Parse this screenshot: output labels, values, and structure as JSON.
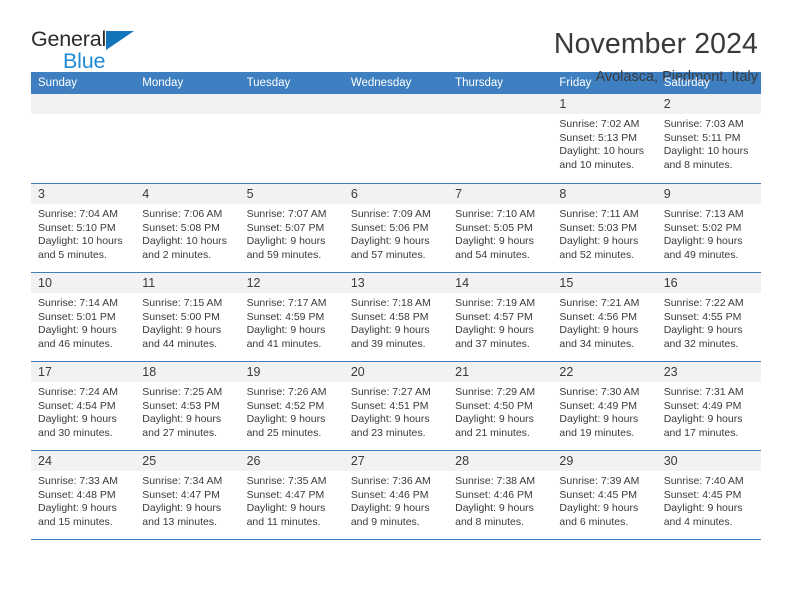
{
  "brand": {
    "name_part1": "General",
    "name_part2": "Blue",
    "logo_icon": "triangle-logo-icon",
    "accent_color": "#1275bc"
  },
  "header": {
    "month_title": "November 2024",
    "location": "Avolasca, Piedmont, Italy"
  },
  "calendar": {
    "header_color": "#3d7fc1",
    "daynum_band_color": "#f2f2f2",
    "weekdays": [
      "Sunday",
      "Monday",
      "Tuesday",
      "Wednesday",
      "Thursday",
      "Friday",
      "Saturday"
    ],
    "weeks": [
      [
        {
          "empty": true
        },
        {
          "empty": true
        },
        {
          "empty": true
        },
        {
          "empty": true
        },
        {
          "empty": true
        },
        {
          "day": "1",
          "sunrise": "Sunrise: 7:02 AM",
          "sunset": "Sunset: 5:13 PM",
          "daylight": "Daylight: 10 hours and 10 minutes."
        },
        {
          "day": "2",
          "sunrise": "Sunrise: 7:03 AM",
          "sunset": "Sunset: 5:11 PM",
          "daylight": "Daylight: 10 hours and 8 minutes."
        }
      ],
      [
        {
          "day": "3",
          "sunrise": "Sunrise: 7:04 AM",
          "sunset": "Sunset: 5:10 PM",
          "daylight": "Daylight: 10 hours and 5 minutes."
        },
        {
          "day": "4",
          "sunrise": "Sunrise: 7:06 AM",
          "sunset": "Sunset: 5:08 PM",
          "daylight": "Daylight: 10 hours and 2 minutes."
        },
        {
          "day": "5",
          "sunrise": "Sunrise: 7:07 AM",
          "sunset": "Sunset: 5:07 PM",
          "daylight": "Daylight: 9 hours and 59 minutes."
        },
        {
          "day": "6",
          "sunrise": "Sunrise: 7:09 AM",
          "sunset": "Sunset: 5:06 PM",
          "daylight": "Daylight: 9 hours and 57 minutes."
        },
        {
          "day": "7",
          "sunrise": "Sunrise: 7:10 AM",
          "sunset": "Sunset: 5:05 PM",
          "daylight": "Daylight: 9 hours and 54 minutes."
        },
        {
          "day": "8",
          "sunrise": "Sunrise: 7:11 AM",
          "sunset": "Sunset: 5:03 PM",
          "daylight": "Daylight: 9 hours and 52 minutes."
        },
        {
          "day": "9",
          "sunrise": "Sunrise: 7:13 AM",
          "sunset": "Sunset: 5:02 PM",
          "daylight": "Daylight: 9 hours and 49 minutes."
        }
      ],
      [
        {
          "day": "10",
          "sunrise": "Sunrise: 7:14 AM",
          "sunset": "Sunset: 5:01 PM",
          "daylight": "Daylight: 9 hours and 46 minutes."
        },
        {
          "day": "11",
          "sunrise": "Sunrise: 7:15 AM",
          "sunset": "Sunset: 5:00 PM",
          "daylight": "Daylight: 9 hours and 44 minutes."
        },
        {
          "day": "12",
          "sunrise": "Sunrise: 7:17 AM",
          "sunset": "Sunset: 4:59 PM",
          "daylight": "Daylight: 9 hours and 41 minutes."
        },
        {
          "day": "13",
          "sunrise": "Sunrise: 7:18 AM",
          "sunset": "Sunset: 4:58 PM",
          "daylight": "Daylight: 9 hours and 39 minutes."
        },
        {
          "day": "14",
          "sunrise": "Sunrise: 7:19 AM",
          "sunset": "Sunset: 4:57 PM",
          "daylight": "Daylight: 9 hours and 37 minutes."
        },
        {
          "day": "15",
          "sunrise": "Sunrise: 7:21 AM",
          "sunset": "Sunset: 4:56 PM",
          "daylight": "Daylight: 9 hours and 34 minutes."
        },
        {
          "day": "16",
          "sunrise": "Sunrise: 7:22 AM",
          "sunset": "Sunset: 4:55 PM",
          "daylight": "Daylight: 9 hours and 32 minutes."
        }
      ],
      [
        {
          "day": "17",
          "sunrise": "Sunrise: 7:24 AM",
          "sunset": "Sunset: 4:54 PM",
          "daylight": "Daylight: 9 hours and 30 minutes."
        },
        {
          "day": "18",
          "sunrise": "Sunrise: 7:25 AM",
          "sunset": "Sunset: 4:53 PM",
          "daylight": "Daylight: 9 hours and 27 minutes."
        },
        {
          "day": "19",
          "sunrise": "Sunrise: 7:26 AM",
          "sunset": "Sunset: 4:52 PM",
          "daylight": "Daylight: 9 hours and 25 minutes."
        },
        {
          "day": "20",
          "sunrise": "Sunrise: 7:27 AM",
          "sunset": "Sunset: 4:51 PM",
          "daylight": "Daylight: 9 hours and 23 minutes."
        },
        {
          "day": "21",
          "sunrise": "Sunrise: 7:29 AM",
          "sunset": "Sunset: 4:50 PM",
          "daylight": "Daylight: 9 hours and 21 minutes."
        },
        {
          "day": "22",
          "sunrise": "Sunrise: 7:30 AM",
          "sunset": "Sunset: 4:49 PM",
          "daylight": "Daylight: 9 hours and 19 minutes."
        },
        {
          "day": "23",
          "sunrise": "Sunrise: 7:31 AM",
          "sunset": "Sunset: 4:49 PM",
          "daylight": "Daylight: 9 hours and 17 minutes."
        }
      ],
      [
        {
          "day": "24",
          "sunrise": "Sunrise: 7:33 AM",
          "sunset": "Sunset: 4:48 PM",
          "daylight": "Daylight: 9 hours and 15 minutes."
        },
        {
          "day": "25",
          "sunrise": "Sunrise: 7:34 AM",
          "sunset": "Sunset: 4:47 PM",
          "daylight": "Daylight: 9 hours and 13 minutes."
        },
        {
          "day": "26",
          "sunrise": "Sunrise: 7:35 AM",
          "sunset": "Sunset: 4:47 PM",
          "daylight": "Daylight: 9 hours and 11 minutes."
        },
        {
          "day": "27",
          "sunrise": "Sunrise: 7:36 AM",
          "sunset": "Sunset: 4:46 PM",
          "daylight": "Daylight: 9 hours and 9 minutes."
        },
        {
          "day": "28",
          "sunrise": "Sunrise: 7:38 AM",
          "sunset": "Sunset: 4:46 PM",
          "daylight": "Daylight: 9 hours and 8 minutes."
        },
        {
          "day": "29",
          "sunrise": "Sunrise: 7:39 AM",
          "sunset": "Sunset: 4:45 PM",
          "daylight": "Daylight: 9 hours and 6 minutes."
        },
        {
          "day": "30",
          "sunrise": "Sunrise: 7:40 AM",
          "sunset": "Sunset: 4:45 PM",
          "daylight": "Daylight: 9 hours and 4 minutes."
        }
      ]
    ]
  }
}
